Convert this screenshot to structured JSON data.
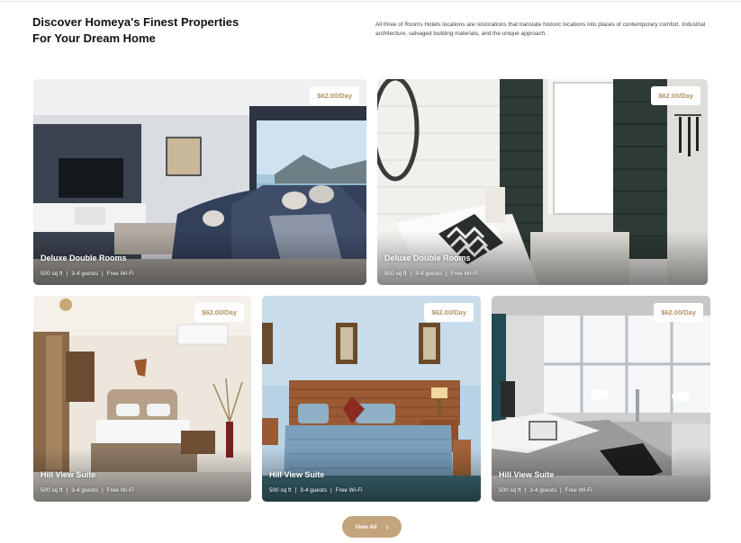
{
  "header": {
    "headline": "Discover Homeya's Finest Properties For Your Dream Home",
    "intro": "All three of Rooms Hotels locations are restorations that translate historic locations into places of contemporary comfort. Industrial architecture, salvaged building materials, and the unique approach."
  },
  "cards": [
    {
      "price": "$62.00/Day",
      "title": "Deluxe Double Rooms",
      "area": "500 sq ft",
      "guests": "3-4 guests",
      "wifi": "Free Wi-Fi"
    },
    {
      "price": "$62.00/Day",
      "title": "Deluxe Double Rooms",
      "area": "500 sq ft",
      "guests": "3-4 guests",
      "wifi": "Free Wi-Fi"
    },
    {
      "price": "$62.00/Day",
      "title": "Hill View Suite",
      "area": "500 sq ft",
      "guests": "3-4 guests",
      "wifi": "Free Wi-Fi"
    },
    {
      "price": "$62.00/Day",
      "title": "Hill View Suite",
      "area": "500 sq ft",
      "guests": "3-4 guests",
      "wifi": "Free Wi-Fi"
    },
    {
      "price": "$62.00/Day",
      "title": "Hill View Suite",
      "area": "500 sq ft",
      "guests": "3-4 guests",
      "wifi": "Free Wi-Fi"
    }
  ],
  "actions": {
    "view_all_label": "View All"
  },
  "colors": {
    "accent": "#c4a47c",
    "price_text": "#b39164"
  },
  "icons": {
    "view_all": "chevron-right-icon"
  }
}
